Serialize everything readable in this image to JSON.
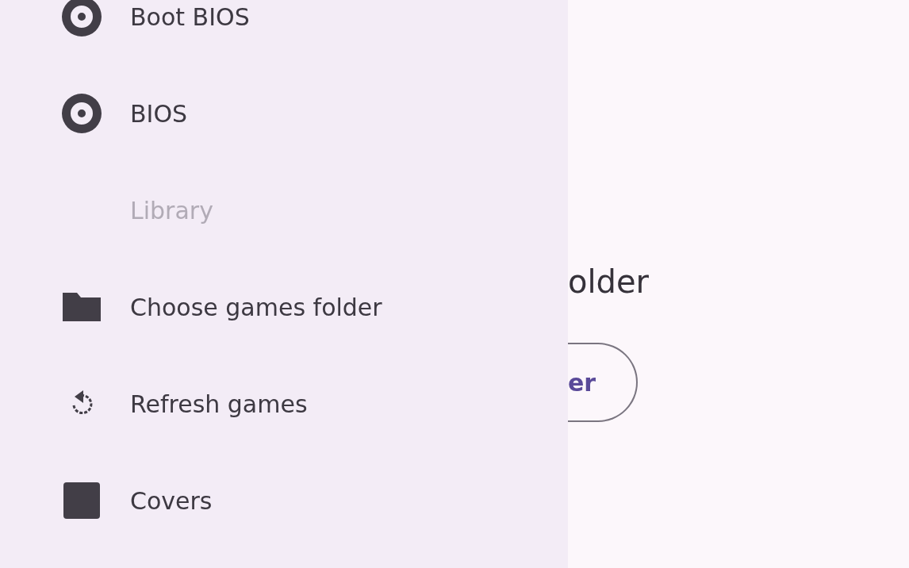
{
  "drawer": {
    "items": [
      {
        "kind": "item",
        "label": "Boot BIOS"
      },
      {
        "kind": "item",
        "label": "BIOS"
      },
      {
        "kind": "header",
        "label": "Library"
      },
      {
        "kind": "item",
        "label": "Choose games folder"
      },
      {
        "kind": "item",
        "label": "Refresh games"
      },
      {
        "kind": "item",
        "label": "Covers"
      }
    ]
  },
  "main": {
    "title": "older",
    "button": "er"
  }
}
